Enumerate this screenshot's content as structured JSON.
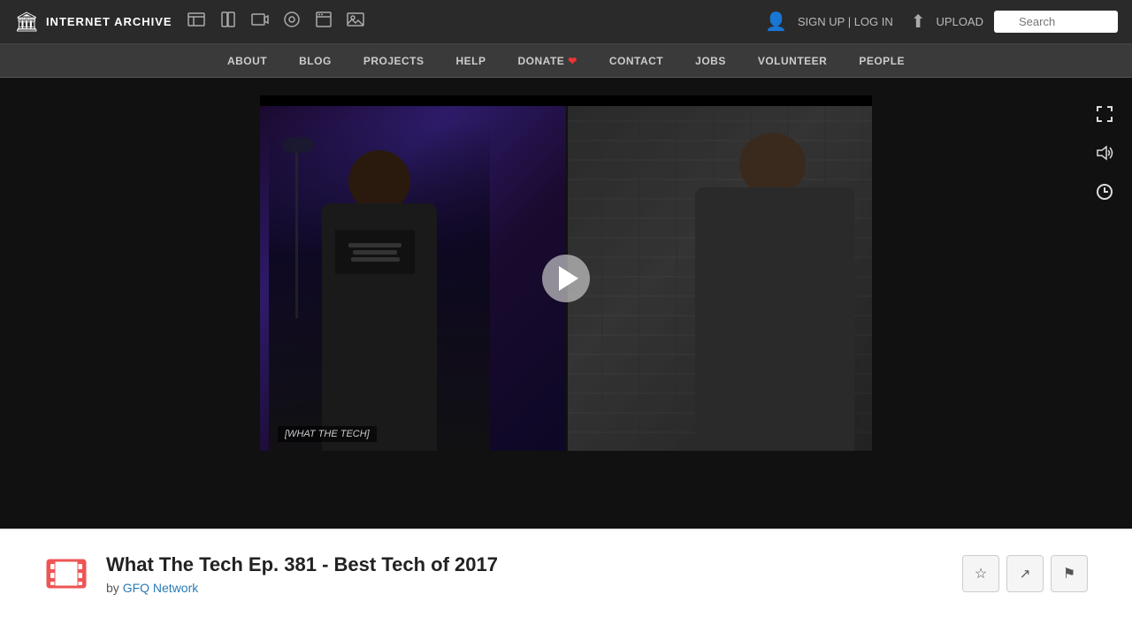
{
  "topNav": {
    "logoText": "INTERNET ARCHIVE",
    "signLogLabel": "SIGN UP | LOG IN",
    "uploadLabel": "UPLOAD",
    "searchPlaceholder": "Search"
  },
  "navIcons": [
    {
      "name": "web-icon",
      "symbol": "🏛"
    },
    {
      "name": "books-icon",
      "symbol": "📚"
    },
    {
      "name": "video-icon",
      "symbol": "🎬"
    },
    {
      "name": "audio-icon",
      "symbol": "🎵"
    },
    {
      "name": "software-icon",
      "symbol": "💾"
    },
    {
      "name": "images-icon",
      "symbol": "🖼"
    }
  ],
  "secondaryNav": {
    "items": [
      {
        "label": "ABOUT",
        "name": "about"
      },
      {
        "label": "BLOG",
        "name": "blog"
      },
      {
        "label": "PROJECTS",
        "name": "projects"
      },
      {
        "label": "HELP",
        "name": "help"
      },
      {
        "label": "DONATE",
        "name": "donate",
        "hasHeart": true
      },
      {
        "label": "CONTACT",
        "name": "contact"
      },
      {
        "label": "JOBS",
        "name": "jobs"
      },
      {
        "label": "VOLUNTEER",
        "name": "volunteer"
      },
      {
        "label": "PEOPLE",
        "name": "people"
      }
    ]
  },
  "sideControls": [
    {
      "name": "fullscreen-icon",
      "symbol": "⛶"
    },
    {
      "name": "volume-icon",
      "symbol": "🔊"
    },
    {
      "name": "history-icon",
      "symbol": "🕐"
    }
  ],
  "video": {
    "captionText": "[WHAT THE TECH]",
    "playButtonLabel": "Play"
  },
  "bottomBar": {
    "title": "What The Tech Ep. 381 - Best Tech of 2017",
    "byText": "by",
    "authorName": "GFQ Network",
    "authorLink": "#"
  },
  "actionButtons": [
    {
      "name": "favorite-button",
      "symbol": "☆",
      "label": "Favorite"
    },
    {
      "name": "share-button",
      "symbol": "⤴",
      "label": "Share"
    },
    {
      "name": "flag-button",
      "symbol": "⚑",
      "label": "Flag"
    }
  ]
}
